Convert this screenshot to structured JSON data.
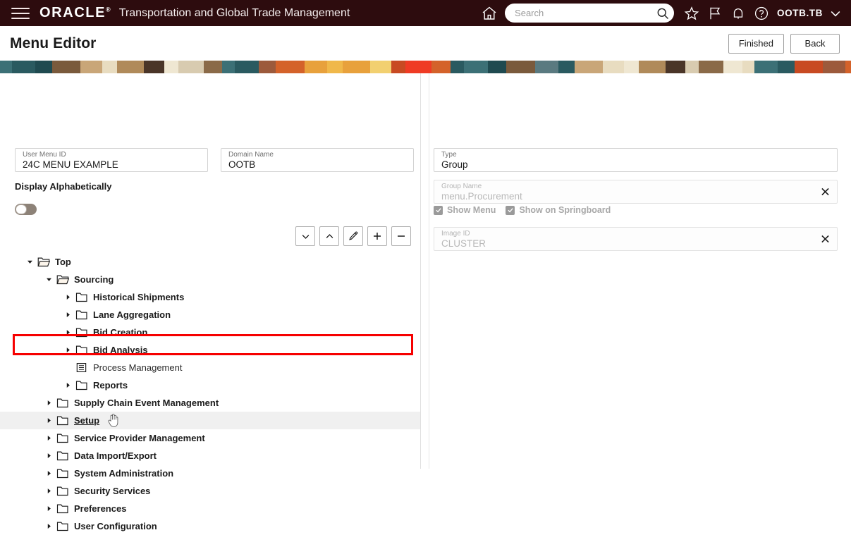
{
  "header": {
    "menu_icon": "hamburger-menu-icon",
    "brand": "ORACLE",
    "brand_mark": "®",
    "app_title": "Transportation and Global Trade Management",
    "home_icon": "home-icon",
    "search": {
      "value": "",
      "placeholder": "Search",
      "icon": "search-icon"
    },
    "favorites_icon": "star-icon",
    "flag_icon": "flag-icon",
    "notifications_icon": "bell-icon",
    "help_icon": "question-circle-icon",
    "user": "OOTB.TB",
    "user_caret_icon": "chevron-down-icon"
  },
  "page": {
    "title": "Menu Editor",
    "actions": [
      {
        "label": "Finished",
        "name": "finished-button"
      },
      {
        "label": "Back",
        "name": "back-button"
      }
    ]
  },
  "banner": {
    "colors": [
      "#3c7076",
      "#2a5a60",
      "#1f4a50",
      "#7a5a3c",
      "#c9a678",
      "#e8dcc0",
      "#b08a5a",
      "#4a3528",
      "#efe7d2",
      "#d8cbb0",
      "#8a6a48",
      "#3c7076",
      "#2a5a60",
      "#9c5a3c",
      "#d4622a",
      "#e8a13c",
      "#f0b84a",
      "#e8a13c",
      "#f2d070",
      "#c84a22",
      "#ef3b24",
      "#d4622a",
      "#2a5a60",
      "#3c7076",
      "#1f4a50",
      "#7a5a3c",
      "#5a7a80",
      "#2a5a60",
      "#c9a678",
      "#e8dcc0",
      "#efe7d2",
      "#b08a5a",
      "#4a3528",
      "#d8cbb0",
      "#8a6a48",
      "#efe7d2",
      "#e8dcc0",
      "#3c7076",
      "#2a5a60",
      "#c84a22",
      "#9c5a3c",
      "#d4622a",
      "#e8a13c"
    ]
  },
  "left_panel": {
    "user_menu_id": {
      "label": "User Menu ID",
      "value": "24C MENU EXAMPLE"
    },
    "domain_name": {
      "label": "Domain Name",
      "value": "OOTB"
    },
    "display_alphabetically": {
      "label": "Display Alphabetically",
      "state": "off"
    },
    "toolbar": [
      {
        "name": "move-down-button",
        "icon": "chevron-down-icon"
      },
      {
        "name": "move-up-button",
        "icon": "chevron-up-icon"
      },
      {
        "name": "edit-button",
        "icon": "pencil-icon"
      },
      {
        "name": "add-button",
        "icon": "plus-icon"
      },
      {
        "name": "remove-button",
        "icon": "minus-icon"
      }
    ],
    "tree": [
      {
        "label": "Top",
        "depth": 0,
        "icon": "folder-open-icon",
        "arrow": "down",
        "state": "expanded"
      },
      {
        "label": "Sourcing",
        "depth": 1,
        "icon": "folder-open-icon",
        "arrow": "down",
        "state": "expanded"
      },
      {
        "label": "Historical Shipments",
        "depth": 2,
        "icon": "folder-icon",
        "arrow": "right",
        "state": "collapsed"
      },
      {
        "label": "Lane Aggregation",
        "depth": 2,
        "icon": "folder-icon",
        "arrow": "right",
        "state": "collapsed"
      },
      {
        "label": "Bid Creation",
        "depth": 2,
        "icon": "folder-icon",
        "arrow": "right",
        "state": "collapsed"
      },
      {
        "label": "Bid Analysis",
        "depth": 2,
        "icon": "folder-icon",
        "arrow": "right",
        "state": "collapsed"
      },
      {
        "label": "Process Management",
        "depth": 2,
        "icon": "document-icon",
        "arrow": "none",
        "state": "leaf"
      },
      {
        "label": "Reports",
        "depth": 2,
        "icon": "folder-icon",
        "arrow": "right",
        "state": "collapsed"
      },
      {
        "label": "Supply Chain Event Management",
        "depth": 1,
        "icon": "folder-icon",
        "arrow": "right",
        "state": "collapsed"
      },
      {
        "label": "Setup",
        "depth": 1,
        "icon": "folder-icon",
        "arrow": "right",
        "state": "collapsed",
        "highlighted": true,
        "underlined": true
      },
      {
        "label": "Service Provider Management",
        "depth": 1,
        "icon": "folder-icon",
        "arrow": "right",
        "state": "collapsed"
      },
      {
        "label": "Data Import/Export",
        "depth": 1,
        "icon": "folder-icon",
        "arrow": "right",
        "state": "collapsed"
      },
      {
        "label": "System Administration",
        "depth": 1,
        "icon": "folder-icon",
        "arrow": "right",
        "state": "collapsed"
      },
      {
        "label": "Security Services",
        "depth": 1,
        "icon": "folder-icon",
        "arrow": "right",
        "state": "collapsed"
      },
      {
        "label": "Preferences",
        "depth": 1,
        "icon": "folder-icon",
        "arrow": "right",
        "state": "collapsed"
      },
      {
        "label": "User Configuration",
        "depth": 1,
        "icon": "folder-icon",
        "arrow": "right",
        "state": "collapsed"
      }
    ],
    "cursor": "pointing-hand-cursor",
    "annotation": {
      "color": "#f60000",
      "target": "Setup"
    }
  },
  "right_panel": {
    "type": {
      "label": "Type",
      "value": "Group"
    },
    "group_name": {
      "label": "Group Name",
      "value": "menu.Procurement",
      "disabled": true,
      "clear_icon": "close-icon"
    },
    "show_menu": {
      "label": "Show Menu",
      "checked": true,
      "disabled": true
    },
    "show_on_springboard": {
      "label": "Show on Springboard",
      "checked": true,
      "disabled": true
    },
    "image_id": {
      "label": "Image ID",
      "value": "CLUSTER",
      "disabled": true,
      "clear_icon": "close-icon"
    }
  }
}
